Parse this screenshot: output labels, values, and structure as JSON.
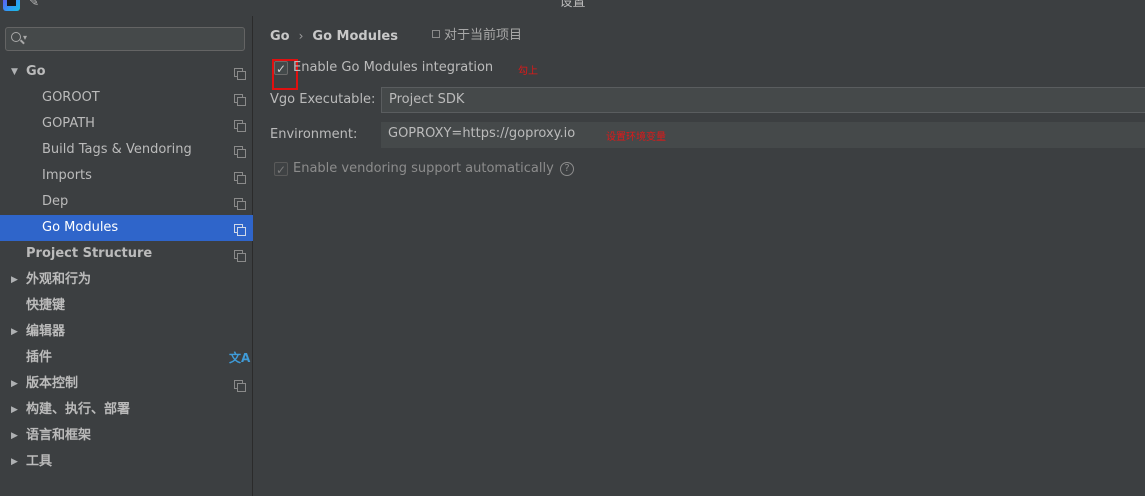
{
  "window": {
    "title": "设置",
    "app_icon": "goland-icon",
    "pin_icon": "pin-icon"
  },
  "sidebar": {
    "search": {
      "value": "",
      "placeholder": ""
    },
    "items": [
      {
        "label": "Go",
        "level": 0,
        "expanded": true,
        "has_arrow": true,
        "arrow": "▼",
        "icon": "project-icon"
      },
      {
        "label": "GOROOT",
        "level": 1,
        "icon": "project-icon"
      },
      {
        "label": "GOPATH",
        "level": 1,
        "icon": "project-icon"
      },
      {
        "label": "Build Tags & Vendoring",
        "level": 1,
        "icon": "project-icon"
      },
      {
        "label": "Imports",
        "level": 1,
        "icon": "project-icon"
      },
      {
        "label": "Dep",
        "level": 1,
        "icon": "project-icon"
      },
      {
        "label": "Go Modules",
        "level": 1,
        "selected": true,
        "icon": "project-icon"
      },
      {
        "label": "Project Structure",
        "level": 0,
        "icon": "project-icon"
      },
      {
        "label": "外观和行为",
        "level": 0,
        "has_arrow": true,
        "arrow": "▶"
      },
      {
        "label": "快捷键",
        "level": 0
      },
      {
        "label": "编辑器",
        "level": 0,
        "has_arrow": true,
        "arrow": "▶"
      },
      {
        "label": "插件",
        "level": 0,
        "icon": "translate-icon",
        "icon_glyph": "文A"
      },
      {
        "label": "版本控制",
        "level": 0,
        "has_arrow": true,
        "arrow": "▶",
        "icon": "project-icon"
      },
      {
        "label": "构建、执行、部署",
        "level": 0,
        "has_arrow": true,
        "arrow": "▶"
      },
      {
        "label": "语言和框架",
        "level": 0,
        "has_arrow": true,
        "arrow": "▶"
      },
      {
        "label": "工具",
        "level": 0,
        "has_arrow": true,
        "arrow": "▶"
      }
    ]
  },
  "breadcrumb": {
    "items": [
      "Go",
      "Go Modules"
    ],
    "separator": "›",
    "scope_label": "对于当前项目"
  },
  "settings": {
    "enable_modules": {
      "label": "Enable Go Modules integration",
      "checked": true,
      "check_glyph": "✓",
      "annotation": "勾上"
    },
    "vgo_executable": {
      "label": "Vgo Executable:",
      "value": "Project SDK"
    },
    "environment": {
      "label": "Environment:",
      "value": "GOPROXY=https://goproxy.io",
      "annotation": "设置环境变量"
    },
    "enable_vendoring": {
      "label": "Enable vendoring support automatically",
      "checked": true,
      "disabled": true,
      "check_glyph": "✓",
      "help_glyph": "?"
    }
  },
  "colors": {
    "background": "#3c3f41",
    "selection": "#2f65ca",
    "annotation_red": "#e01818",
    "field_background": "#45494a"
  }
}
